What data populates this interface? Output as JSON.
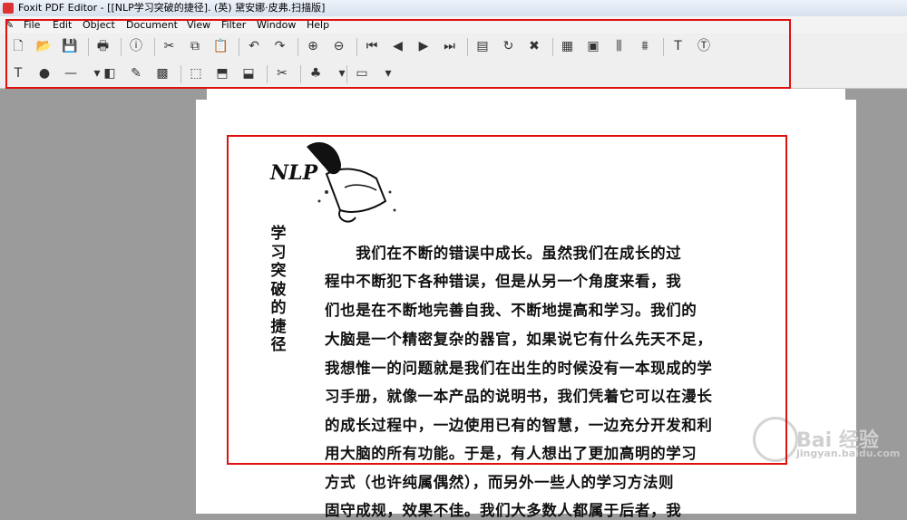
{
  "window": {
    "title": "Foxit PDF Editor - [[NLP学习突破的捷径]. (英) 黛安娜·皮弗.扫描版]"
  },
  "menu": [
    "File",
    "Edit",
    "Object",
    "Document",
    "View",
    "Filter",
    "Window",
    "Help"
  ],
  "toolbar1": [
    {
      "name": "new-icon",
      "glyph": "🗋"
    },
    {
      "name": "open-icon",
      "glyph": "📂"
    },
    {
      "name": "save-icon",
      "glyph": "💾"
    },
    {
      "name": "print-icon",
      "glyph": "🖶"
    },
    {
      "name": "info-icon",
      "glyph": "ⓘ"
    },
    {
      "name": "cut-icon",
      "glyph": "✂"
    },
    {
      "name": "copy-icon",
      "glyph": "⧉"
    },
    {
      "name": "paste-icon",
      "glyph": "📋"
    },
    {
      "name": "undo-icon",
      "glyph": "↶"
    },
    {
      "name": "redo-icon",
      "glyph": "↷"
    },
    {
      "name": "zoom-in-icon",
      "glyph": "⊕"
    },
    {
      "name": "zoom-out-icon",
      "glyph": "⊖"
    },
    {
      "name": "first-page-icon",
      "glyph": "⏮"
    },
    {
      "name": "prev-page-icon",
      "glyph": "◀"
    },
    {
      "name": "next-page-icon",
      "glyph": "▶"
    },
    {
      "name": "last-page-icon",
      "glyph": "⏭"
    },
    {
      "name": "page-properties-icon",
      "glyph": "▤"
    },
    {
      "name": "rotate-page-icon",
      "glyph": "↻"
    },
    {
      "name": "delete-page-icon",
      "glyph": "✖"
    },
    {
      "name": "grid-icon",
      "glyph": "▦"
    },
    {
      "name": "text-layout-icon",
      "glyph": "▣"
    },
    {
      "name": "align-icon",
      "glyph": "⫼"
    },
    {
      "name": "distribute-icon",
      "glyph": "⩩"
    },
    {
      "name": "text-box-icon",
      "glyph": "T"
    },
    {
      "name": "font-icon",
      "glyph": "Ⓣ"
    }
  ],
  "toolbar2": [
    {
      "name": "add-text-icon",
      "glyph": "T"
    },
    {
      "name": "color-icon",
      "glyph": "●"
    },
    {
      "name": "line-icon",
      "glyph": "—"
    },
    {
      "name": "line-dropdown-icon",
      "glyph": "▾"
    },
    {
      "name": "shape-icon",
      "glyph": "◧"
    },
    {
      "name": "edit-image-icon",
      "glyph": "✎"
    },
    {
      "name": "insert-image-icon",
      "glyph": "▩"
    },
    {
      "name": "select-object-icon",
      "glyph": "⬚"
    },
    {
      "name": "transform-icon",
      "glyph": "⬒"
    },
    {
      "name": "scale-icon",
      "glyph": "⬓"
    },
    {
      "name": "clip-icon",
      "glyph": "✂"
    },
    {
      "name": "fill-icon",
      "glyph": "♣"
    },
    {
      "name": "fill-dropdown-icon",
      "glyph": "▾"
    },
    {
      "name": "layer-icon",
      "glyph": "▭"
    },
    {
      "name": "layer-dropdown-icon",
      "glyph": "▾"
    }
  ],
  "document": {
    "logo_text": "NLP",
    "vertical_title": [
      "学",
      "习",
      "突",
      "破",
      "的",
      "捷",
      "径"
    ],
    "lines": [
      "　　我们在不断的错误中成长。虽然我们在成长的过",
      "程中不断犯下各种错误，但是从另一个角度来看，我",
      "们也是在不断地完善自我、不断地提高和学习。我们的",
      "大脑是一个精密复杂的器官，如果说它有什么先天不足，",
      "我想惟一的问题就是我们在出生的时候没有一本现成的学",
      "习手册，就像一本产品的说明书，我们凭着它可以在漫长",
      "的成长过程中，一边使用已有的智慧，一边充分开发和利",
      "用大脑的所有功能。于是，有人想出了更加高明的学习",
      "方式（也许纯属偶然），而另外一些人的学习方法则",
      "固守成规，效果不佳。我们大多数人都属于后者，我"
    ]
  },
  "watermark": {
    "text": "Bai 经验",
    "url": "jingyan.baidu.com"
  },
  "colors": {
    "highlight": "#e01010"
  }
}
